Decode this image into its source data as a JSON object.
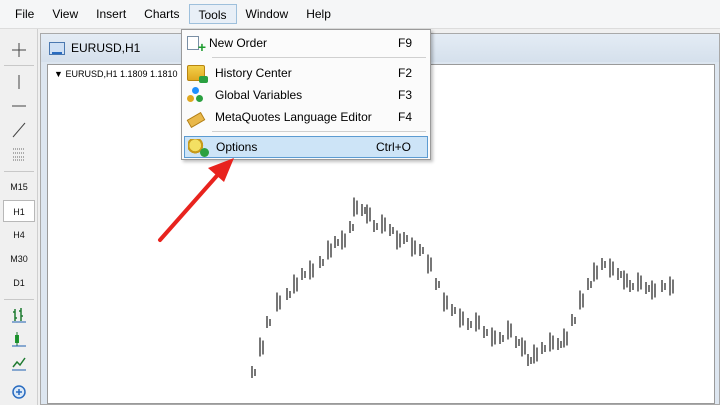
{
  "menubar": {
    "items": [
      "File",
      "View",
      "Insert",
      "Charts",
      "Tools",
      "Window",
      "Help"
    ],
    "active": "Tools"
  },
  "toolbar": {
    "timeframes": [
      "M15",
      "H1",
      "H4",
      "M30",
      "D1"
    ],
    "selected_timeframe": "H1"
  },
  "chart_window": {
    "title": "EURUSD,H1",
    "symbol_info": "EURUSD,H1  1.1809 1.1810"
  },
  "tools_menu": {
    "items": [
      {
        "label": "New Order",
        "shortcut": "F9",
        "icon": "new-order-icon"
      },
      {
        "label": "History Center",
        "shortcut": "F2",
        "icon": "history-center-icon"
      },
      {
        "label": "Global Variables",
        "shortcut": "F3",
        "icon": "global-variables-icon"
      },
      {
        "label": "MetaQuotes Language Editor",
        "shortcut": "F4",
        "icon": "metaeditor-icon"
      },
      {
        "label": "Options",
        "shortcut": "Ctrl+O",
        "icon": "options-icon",
        "highlighted": true
      }
    ]
  },
  "annotation": {
    "arrow_color": "#e8231e"
  },
  "colors": {
    "highlight_bg": "#cde4f7",
    "highlight_border": "#5c9bd1",
    "price_line": "#555555"
  }
}
